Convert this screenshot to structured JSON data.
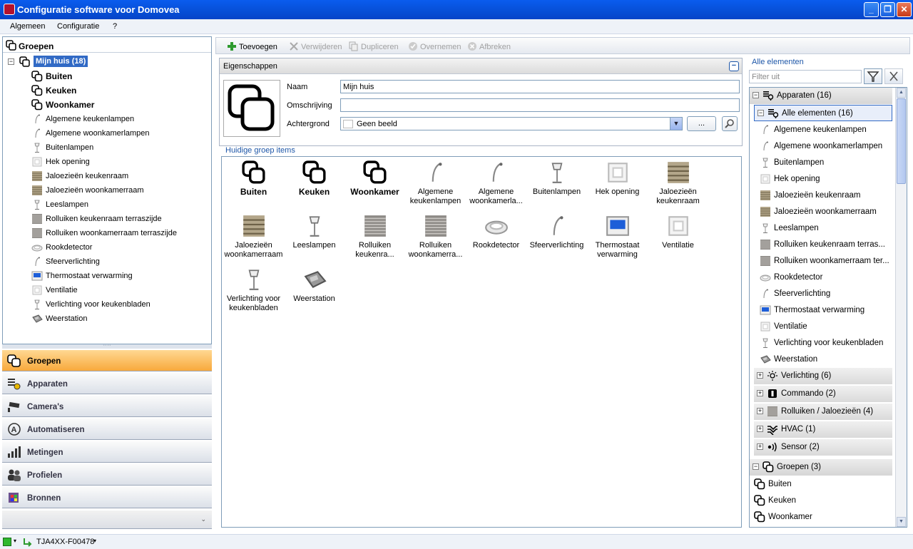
{
  "window": {
    "title": "Configuratie software voor Domovea"
  },
  "menu": [
    "Algemeen",
    "Configuratie",
    "?"
  ],
  "left_tree": {
    "header": "Groepen",
    "root": "Mijn huis (18)",
    "groups": [
      "Buiten",
      "Keuken",
      "Woonkamer"
    ],
    "items": [
      {
        "label": "Algemene keukenlampen",
        "icon": "ceiling-lamp-icon"
      },
      {
        "label": "Algemene woonkamerlampen",
        "icon": "ceiling-lamp-icon"
      },
      {
        "label": "Buitenlampen",
        "icon": "floor-lamp-icon"
      },
      {
        "label": "Hek opening",
        "icon": "switch-icon"
      },
      {
        "label": "Jaloezieën keukenraam",
        "icon": "blinds-icon"
      },
      {
        "label": "Jaloezieën woonkamerraam",
        "icon": "blinds-icon"
      },
      {
        "label": "Leeslampen",
        "icon": "floor-lamp-icon"
      },
      {
        "label": "Rolluiken keukenraam terraszijde",
        "icon": "shutter-icon"
      },
      {
        "label": "Rolluiken woonkamerraam terraszijde",
        "icon": "shutter-icon"
      },
      {
        "label": "Rookdetector",
        "icon": "smoke-detector-icon"
      },
      {
        "label": "Sfeerverlichting",
        "icon": "ceiling-lamp-icon"
      },
      {
        "label": "Thermostaat verwarming",
        "icon": "thermostat-icon"
      },
      {
        "label": "Ventilatie",
        "icon": "switch-icon"
      },
      {
        "label": "Verlichting voor keukenbladen",
        "icon": "floor-lamp-icon"
      },
      {
        "label": "Weerstation",
        "icon": "weather-station-icon"
      }
    ]
  },
  "nav": {
    "groepen": "Groepen",
    "apparaten": "Apparaten",
    "cameras": "Camera's",
    "automatiseren": "Automatiseren",
    "metingen": "Metingen",
    "profielen": "Profielen",
    "bronnen": "Bronnen"
  },
  "toolbar": {
    "add": "Toevoegen",
    "remove": "Verwijderen",
    "duplicate": "Dupliceren",
    "apply": "Overnemen",
    "cancel": "Afbreken"
  },
  "props": {
    "title": "Eigenschappen",
    "name_label": "Naam",
    "name_value": "Mijn huis",
    "desc_label": "Omschrijving",
    "desc_value": "",
    "bg_label": "Achtergrond",
    "bg_value": "Geen beeld",
    "browse": "..."
  },
  "current_items": {
    "title": "Huidige groep items",
    "items": [
      {
        "l1": "Buiten",
        "l2": "",
        "icon": "group-icon",
        "bold": true
      },
      {
        "l1": "Keuken",
        "l2": "",
        "icon": "group-icon",
        "bold": true
      },
      {
        "l1": "Woonkamer",
        "l2": "",
        "icon": "group-icon",
        "bold": true
      },
      {
        "l1": "Algemene",
        "l2": "keukenlampen",
        "icon": "ceiling-lamp-icon"
      },
      {
        "l1": "Algemene",
        "l2": "woonkamerla...",
        "icon": "ceiling-lamp-icon"
      },
      {
        "l1": "Buitenlampen",
        "l2": "",
        "icon": "floor-lamp-icon"
      },
      {
        "l1": "Hek opening",
        "l2": "",
        "icon": "switch-icon"
      },
      {
        "l1": "Jaloezieën",
        "l2": "keukenraam",
        "icon": "blinds-icon"
      },
      {
        "l1": "Jaloezieën",
        "l2": "woonkamerraam",
        "icon": "blinds-icon"
      },
      {
        "l1": "Leeslampen",
        "l2": "",
        "icon": "floor-lamp-icon"
      },
      {
        "l1": "Rolluiken",
        "l2": "keukenra...",
        "icon": "shutter-icon"
      },
      {
        "l1": "Rolluiken",
        "l2": "woonkamerra...",
        "icon": "shutter-icon"
      },
      {
        "l1": "Rookdetector",
        "l2": "",
        "icon": "smoke-detector-icon"
      },
      {
        "l1": "Sfeerverlichting",
        "l2": "",
        "icon": "ceiling-lamp-icon"
      },
      {
        "l1": "Thermostaat",
        "l2": "verwarming",
        "icon": "thermostat-icon"
      },
      {
        "l1": "Ventilatie",
        "l2": "",
        "icon": "switch-icon"
      },
      {
        "l1": "Verlichting voor",
        "l2": "keukenbladen",
        "icon": "floor-lamp-icon"
      },
      {
        "l1": "Weerstation",
        "l2": "",
        "icon": "weather-station-icon"
      }
    ]
  },
  "right_panel": {
    "title": "Alle elementen",
    "filter_placeholder": "Filter uit",
    "apparaten": "Apparaten (16)",
    "alle": "Alle elementen (16)",
    "elements": [
      {
        "label": "Algemene keukenlampen",
        "icon": "ceiling-lamp-icon"
      },
      {
        "label": "Algemene woonkamerlampen",
        "icon": "ceiling-lamp-icon"
      },
      {
        "label": "Buitenlampen",
        "icon": "floor-lamp-icon"
      },
      {
        "label": "Hek opening",
        "icon": "switch-icon"
      },
      {
        "label": "Jaloezieën keukenraam",
        "icon": "blinds-icon"
      },
      {
        "label": "Jaloezieën woonkamerraam",
        "icon": "blinds-icon"
      },
      {
        "label": "Leeslampen",
        "icon": "floor-lamp-icon"
      },
      {
        "label": "Rolluiken keukenraam terras...",
        "icon": "shutter-icon"
      },
      {
        "label": "Rolluiken woonkamerraam ter...",
        "icon": "shutter-icon"
      },
      {
        "label": "Rookdetector",
        "icon": "smoke-detector-icon"
      },
      {
        "label": "Sfeerverlichting",
        "icon": "ceiling-lamp-icon"
      },
      {
        "label": "Thermostaat verwarming",
        "icon": "thermostat-icon"
      },
      {
        "label": "Ventilatie",
        "icon": "switch-icon"
      },
      {
        "label": "Verlichting voor keukenbladen",
        "icon": "floor-lamp-icon"
      },
      {
        "label": "Weerstation",
        "icon": "weather-station-icon"
      }
    ],
    "categories": [
      {
        "label": "Verlichting (6)",
        "icon": "bulb-icon"
      },
      {
        "label": "Commando (2)",
        "icon": "command-icon"
      },
      {
        "label": "Rolluiken / Jaloezieën (4)",
        "icon": "shutter-icon"
      },
      {
        "label": "HVAC (1)",
        "icon": "hvac-icon"
      },
      {
        "label": "Sensor (2)",
        "icon": "sensor-icon"
      }
    ],
    "groepen": "Groepen (3)",
    "groups": [
      "Buiten",
      "Keuken",
      "Woonkamer"
    ]
  },
  "status": {
    "device": "TJA4XX-F00478"
  }
}
